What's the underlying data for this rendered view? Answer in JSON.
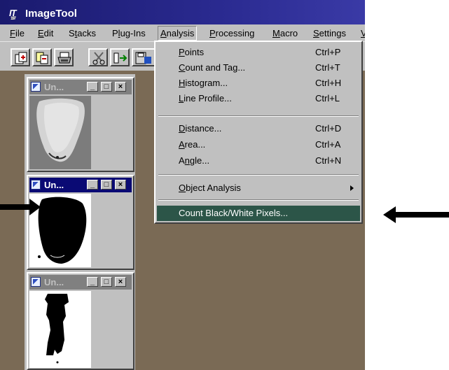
{
  "app": {
    "title": "ImageTool",
    "logo_text": "IT",
    "logo_sub": "197"
  },
  "menubar": {
    "items": [
      {
        "key": "F",
        "rest": "ile"
      },
      {
        "key": "E",
        "rest": "dit"
      },
      {
        "pre": "S",
        "key": "t",
        "rest": "acks"
      },
      {
        "pre": "P",
        "key": "l",
        "rest": "ug-Ins"
      },
      {
        "key": "A",
        "rest": "nalysis"
      },
      {
        "key": "P",
        "rest": "rocessing"
      },
      {
        "key": "M",
        "rest": "acro"
      },
      {
        "key": "S",
        "rest": "ettings"
      },
      {
        "key": "V",
        "rest": ""
      }
    ]
  },
  "toolbar": {
    "buttons": [
      "open-icon",
      "copy-icon",
      "print-icon",
      "cut-icon",
      "flip-icon",
      "save-icon"
    ]
  },
  "documents": [
    {
      "title": "Un...",
      "state": "inactive",
      "image": "gray-blob"
    },
    {
      "title": "Un...",
      "state": "active",
      "image": "black-blob"
    },
    {
      "title": "Un...",
      "state": "inactive",
      "image": "black-figure"
    }
  ],
  "window_buttons": {
    "minimize": "_",
    "maximize": "□",
    "close": "×"
  },
  "analysis_menu": {
    "items": [
      {
        "pre": "",
        "key": "P",
        "rest": "oints",
        "shortcut": "Ctrl+P"
      },
      {
        "pre": "",
        "key": "C",
        "rest": "ount and Tag...",
        "shortcut": "Ctrl+T"
      },
      {
        "pre": "",
        "key": "H",
        "rest": "istogram...",
        "shortcut": "Ctrl+H"
      },
      {
        "pre": "",
        "key": "L",
        "rest": "ine Profile...",
        "shortcut": "Ctrl+L"
      },
      {
        "pre": "",
        "key": "D",
        "rest": "istance...",
        "shortcut": "Ctrl+D"
      },
      {
        "pre": "",
        "key": "A",
        "rest": "rea...",
        "shortcut": "Ctrl+A"
      },
      {
        "pre": "A",
        "key": "n",
        "rest": "gle...",
        "shortcut": "Ctrl+N"
      },
      {
        "pre": "",
        "key": "O",
        "rest": "bject Analysis",
        "shortcut": ""
      },
      {
        "pre": "",
        "key": "",
        "rest": "Count Black/White Pixels...",
        "shortcut": ""
      }
    ]
  },
  "annotations": {
    "left_arrow": "arrow-right-icon",
    "right_arrow": "arrow-left-icon"
  }
}
